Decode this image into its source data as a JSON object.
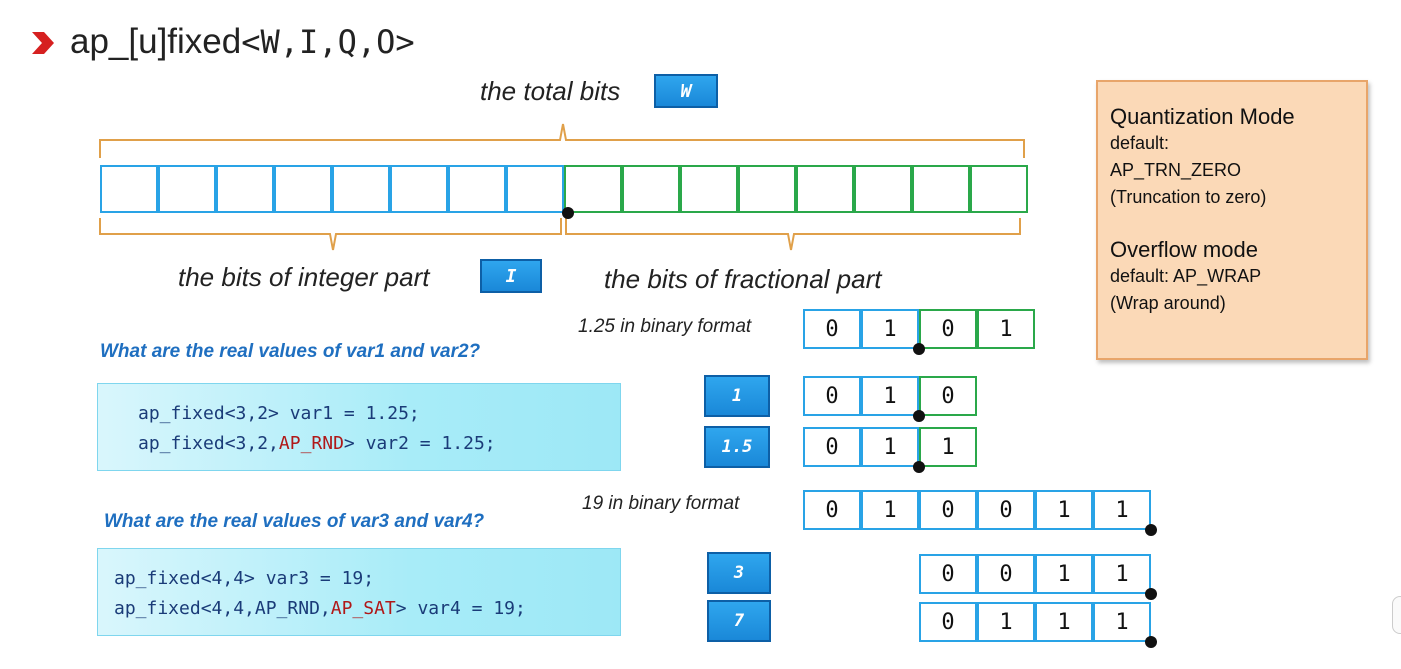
{
  "title": {
    "prefix": "ap_[u]fixed",
    "params": "<W,I,Q,O>"
  },
  "diagram": {
    "total_label": "the total bits",
    "total_badge": "W",
    "integer_label": "the bits of integer part",
    "integer_badge": "I",
    "fractional_label": "the bits of fractional part",
    "integer_bit_count": 8,
    "fractional_bit_count": 8
  },
  "example1": {
    "binary_label": "1.25 in binary format",
    "binary_bits": [
      "0",
      "1",
      "0",
      "1"
    ],
    "binary_point_after": 2,
    "question": "What are the real values of var1 and var2?",
    "code": {
      "line1": "ap_fixed<3,2> var1 = 1.25;",
      "line2_a": "ap_fixed<3,2,",
      "line2_red": "AP_RND",
      "line2_b": "> var2 = 1.25;"
    },
    "results": [
      {
        "value": "1",
        "bits": [
          "0",
          "1",
          "0"
        ]
      },
      {
        "value": "1.5",
        "bits": [
          "0",
          "1",
          "1"
        ]
      }
    ]
  },
  "example2": {
    "binary_label": "19 in binary format",
    "binary_bits": [
      "0",
      "1",
      "0",
      "0",
      "1",
      "1"
    ],
    "question": "What are the real values of var3 and var4?",
    "code": {
      "line1": "ap_fixed<4,4> var3 = 19;",
      "line2_a": "ap_fixed<4,4,AP_RND,",
      "line2_red": "AP_SAT",
      "line2_b": "> var4 = 19;"
    },
    "results": [
      {
        "value": "3",
        "bits": [
          "0",
          "0",
          "1",
          "1"
        ]
      },
      {
        "value": "7",
        "bits": [
          "0",
          "1",
          "1",
          "1"
        ]
      }
    ]
  },
  "info": {
    "quant_title": "Quantization Mode",
    "quant_default_label": "default:",
    "quant_default_value": "AP_TRN_ZERO",
    "quant_desc": "(Truncation to zero)",
    "overflow_title": "Overflow mode",
    "overflow_default": "default: AP_WRAP",
    "overflow_desc": "(Wrap around)"
  },
  "colors": {
    "integer_border": "#29a3e6",
    "fraction_border": "#2aa84a",
    "brace": "#e0a04a",
    "title_chevron": "#d62020",
    "question_text": "#1f6fc0"
  }
}
